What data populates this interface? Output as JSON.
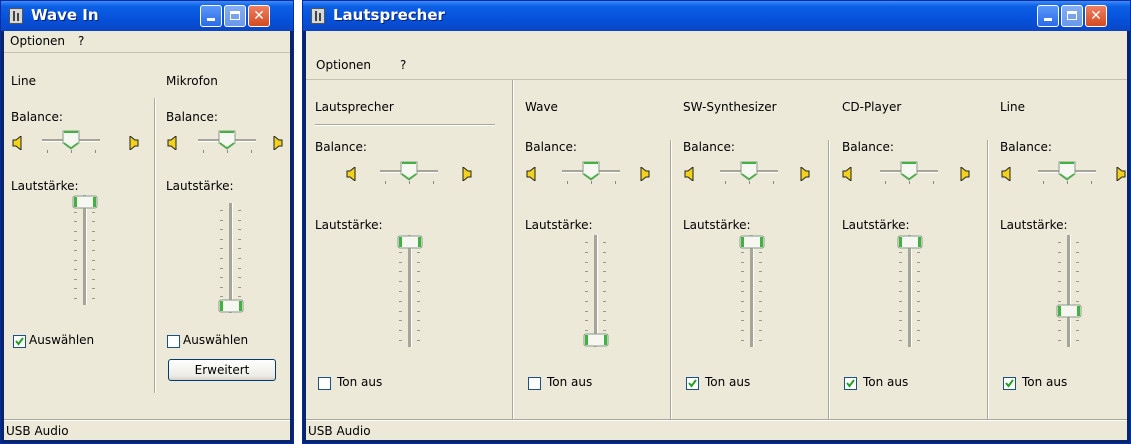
{
  "left_window": {
    "title": "Wave In",
    "menu": [
      "Optionen",
      "?"
    ],
    "status": "USB Audio",
    "channels": [
      {
        "name": "Line",
        "balance_label": "Balance:",
        "balance": 0.5,
        "volume_label": "Lautstärke:",
        "volume": 1.0,
        "checkbox_label": "Auswählen",
        "checked": true
      },
      {
        "name": "Mikrofon",
        "balance_label": "Balance:",
        "balance": 0.5,
        "volume_label": "Lautstärke:",
        "volume": 0.0,
        "checkbox_label": "Auswählen",
        "checked": false,
        "button_label": "Erweitert"
      }
    ]
  },
  "right_window": {
    "title": "Lautsprecher",
    "menu": [
      "Optionen",
      "?"
    ],
    "status": "USB Audio",
    "channels": [
      {
        "name": "Lautsprecher",
        "balance_label": "Balance:",
        "balance": 0.5,
        "volume_label": "Lautstärke:",
        "volume": 1.0,
        "checkbox_label": "Ton aus",
        "checked": false
      },
      {
        "name": "Wave",
        "balance_label": "Balance:",
        "balance": 0.5,
        "volume_label": "Lautstärke:",
        "volume": 0.0,
        "checkbox_label": "Ton aus",
        "checked": false
      },
      {
        "name": "SW-Synthesizer",
        "balance_label": "Balance:",
        "balance": 0.5,
        "volume_label": "Lautstärke:",
        "volume": 1.0,
        "checkbox_label": "Ton aus",
        "checked": true
      },
      {
        "name": "CD-Player",
        "balance_label": "Balance:",
        "balance": 0.5,
        "volume_label": "Lautstärke:",
        "volume": 1.0,
        "checkbox_label": "Ton aus",
        "checked": true
      },
      {
        "name": "Line",
        "balance_label": "Balance:",
        "balance": 0.5,
        "volume_label": "Lautstärke:",
        "volume": 0.3,
        "checkbox_label": "Ton aus",
        "checked": true
      }
    ]
  },
  "icons": {
    "window": "mixer-icon",
    "left_speaker": "speaker-left-icon",
    "right_speaker": "speaker-right-icon",
    "minimize": "minimize-icon",
    "maximize": "maximize-icon",
    "close": "close-icon"
  },
  "colors": {
    "titlebar": "#0652db",
    "face": "#ece9d8",
    "thumb_accent": "#3fb23f",
    "check": "#21a121"
  }
}
